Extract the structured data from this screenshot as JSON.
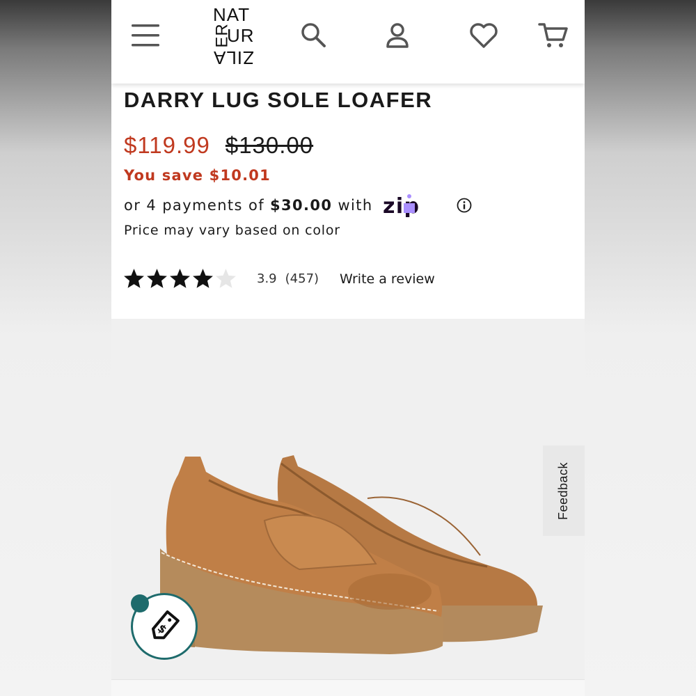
{
  "header": {
    "logo_lines": [
      "NAT",
      "ER",
      "UR",
      "ZIL A"
    ],
    "logo_line1": "NAT",
    "logo_line2a": "ER",
    "logo_line2b": "UR",
    "logo_line3": "ZILA",
    "icons": [
      "menu-icon",
      "search-icon",
      "account-icon",
      "heart-icon",
      "cart-icon"
    ]
  },
  "product": {
    "title": "DARRY LUG SOLE LOAFER",
    "sale_price": "$119.99",
    "original_price": "$130.00",
    "savings": "You save $10.01",
    "installments_prefix": "or 4 payments of",
    "installment_amount": "$30.00",
    "installments_suffix": "with",
    "zip_label": "zip",
    "price_note": "Price may vary based on color",
    "rating": {
      "value": "3.9",
      "count": "(457)",
      "stars_filled": 4,
      "stars_total": 5,
      "write_review": "Write a review"
    }
  },
  "feedback_tab": "Feedback",
  "colors": {
    "sale": "#c0391f",
    "zip_purple": "#aa8fff",
    "zip_dark": "#1a0826",
    "badge": "#1e6b6c",
    "leather": "#b77a45",
    "sole": "#b58b5c"
  }
}
